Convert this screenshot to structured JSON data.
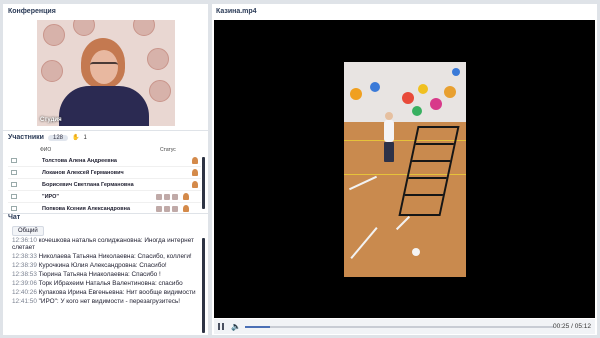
{
  "conference": {
    "title": "Конференция",
    "camera_label": "Студия"
  },
  "participants": {
    "title": "Участники",
    "count": "128",
    "hands_raised": "1",
    "col_name": "ФИО",
    "col_status": "Статус",
    "rows": [
      {
        "name": "Толстова Алена Андреевна"
      },
      {
        "name": "Локанов Алексей Германович"
      },
      {
        "name": "Борисевич Светлана  Германовна"
      },
      {
        "name": "\"ИРО\""
      },
      {
        "name": "Попкова  Ксения  Александровна"
      }
    ]
  },
  "chat": {
    "title": "Чат",
    "tab": "Общий",
    "messages": [
      {
        "time": "12:36:10",
        "text": " кочешкова  наталья солидж­ановна: Иногда интернет слетает"
      },
      {
        "time": "12:38:33",
        "text": " Николаева Татьяна  Николаевна: Спасибо, коллеги!"
      },
      {
        "time": "12:38:39",
        "text": " Курочкина  Юлия   Александровна: Спасибо!"
      },
      {
        "time": "12:38:53",
        "text": " Тюрина Татьяна  Ниаколаевна: Спасибо !"
      },
      {
        "time": "12:39:06",
        "text": " Торк Ибрахеим Наталья  Валентиновна: спасибо"
      },
      {
        "time": "12:40:26",
        "text": " Кулакова   Ирина Евгеньевна: Нит вообще видимости"
      },
      {
        "time": "12:41:50",
        "text": " \"ИРО\": У кого нет видимости - перезагрузитесь!"
      }
    ]
  },
  "video": {
    "title": "Казина.mp4",
    "current_time": "00:25",
    "duration": "05:12",
    "progress_fraction": 0.08
  }
}
